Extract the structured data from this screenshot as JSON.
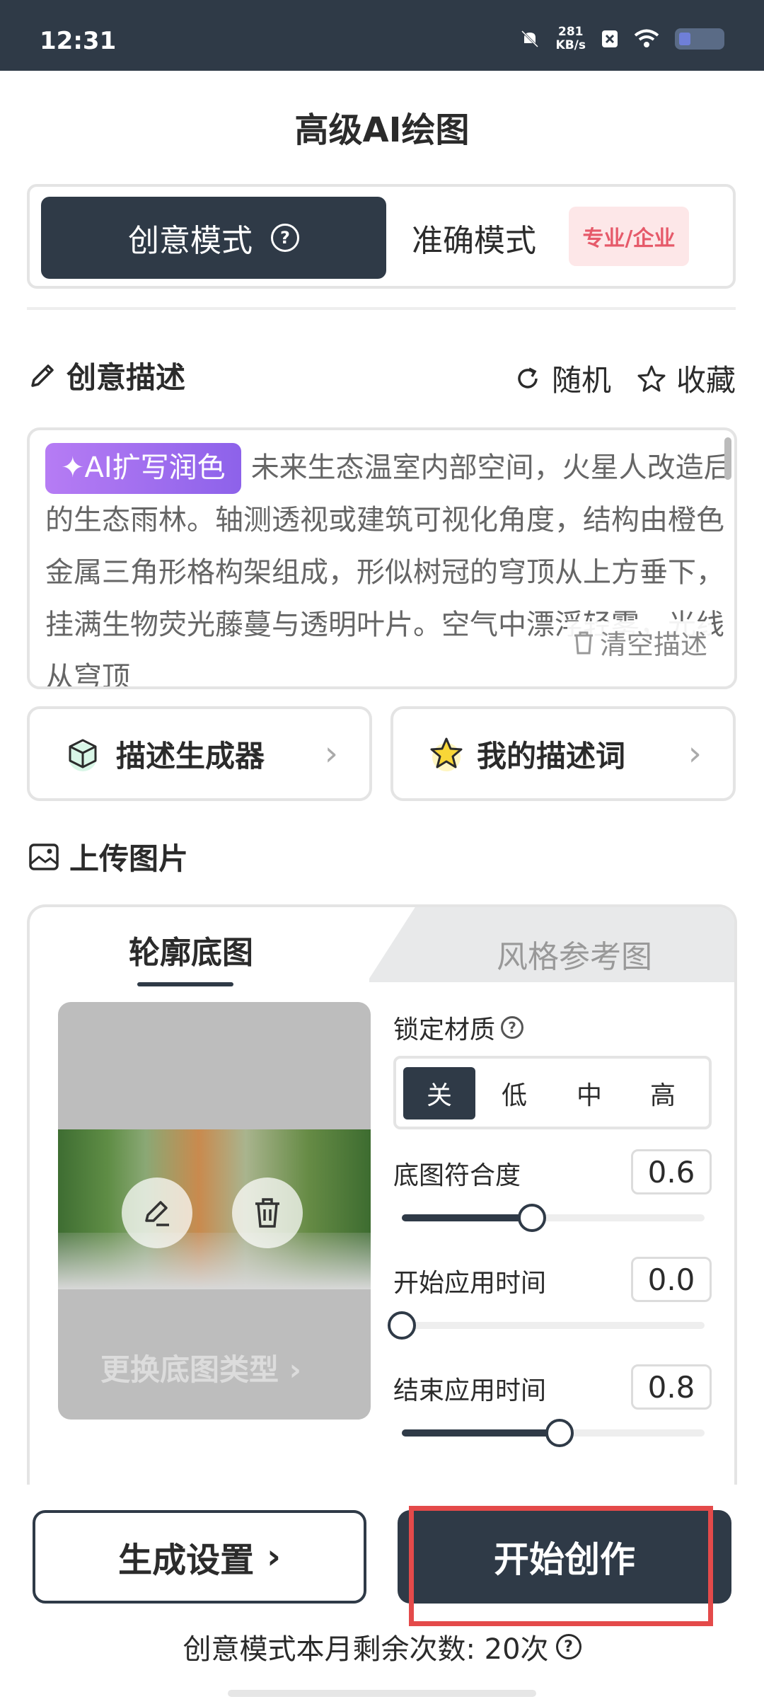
{
  "status_bar": {
    "time": "12:31",
    "speed_value": "281",
    "speed_unit": "KB/s"
  },
  "page": {
    "title": "高级AI绘图"
  },
  "mode": {
    "creative_label": "创意模式",
    "precise_label": "准确模式",
    "pro_badge": "专业/企业"
  },
  "description": {
    "section_title": "创意描述",
    "random_label": "随机",
    "favorite_label": "收藏",
    "ai_chip_label": "AI扩写润色",
    "text": "未来生态温室内部空间，火星人改造后的生态雨林。轴测透视或建筑可视化角度，结构由橙色金属三角形格构架组成，形似树冠的穹顶从上方垂下，挂满生物荧光藤蔓与透明叶片。空气中漂浮轻雾，光线从穹顶",
    "clear_label": "清空描述"
  },
  "generators": {
    "desc_generator": "描述生成器",
    "my_desc": "我的描述词"
  },
  "upload": {
    "section_title": "上传图片",
    "tab_outline": "轮廓底图",
    "tab_style": "风格参考图",
    "change_type": "更换底图类型 ›",
    "lock_material_label": "锁定材质",
    "lock_options": [
      "关",
      "低",
      "中",
      "高"
    ],
    "lock_selected": "关",
    "fit_label": "底图符合度",
    "fit_value": "0.6",
    "start_label": "开始应用时间",
    "start_value": "0.0",
    "end_label": "结束应用时间",
    "end_value": "0.8"
  },
  "bottom": {
    "settings_label": "生成设置",
    "start_label": "开始创作",
    "remaining_text": "创意模式本月剩余次数: 20次"
  },
  "colors": {
    "primary": "#2f3a47",
    "badge_text": "#e65a6a",
    "ai_chip": "#9a6cf0",
    "highlight": "#e44a4a"
  }
}
